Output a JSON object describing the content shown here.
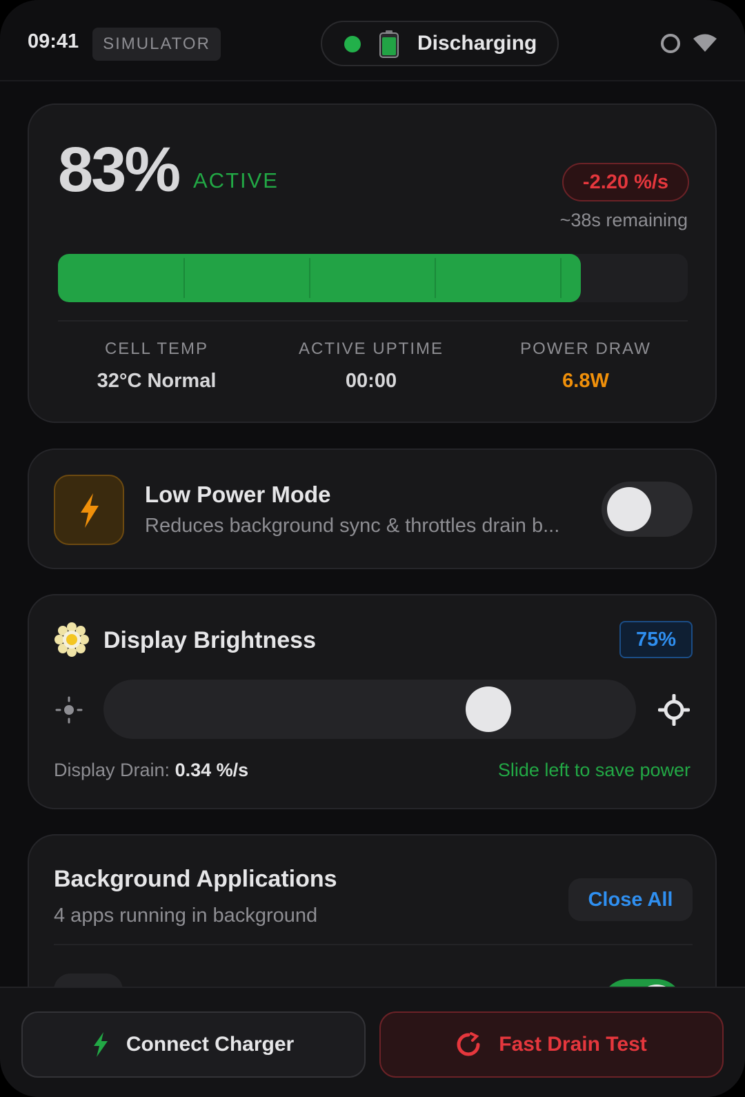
{
  "status_bar": {
    "time": "09:41",
    "mode_badge": "SIMULATOR",
    "charge_state": "Discharging",
    "status_dot_color": "#22b04a"
  },
  "battery": {
    "percent_label": "83%",
    "level_fraction": 0.83,
    "state": "ACTIVE",
    "rate": "-2.20 %/s",
    "remaining": "~38s remaining",
    "stats": [
      {
        "label": "CELL TEMP",
        "value": "32°C Normal"
      },
      {
        "label": "ACTIVE UPTIME",
        "value": "00:00"
      },
      {
        "label": "POWER DRAW",
        "value": "6.8W"
      }
    ],
    "fill_color": "#22a345"
  },
  "low_power": {
    "title": "Low Power Mode",
    "subtitle": "Reduces background sync & throttles drain b...",
    "enabled": false,
    "icon": "lightning-bolt-icon"
  },
  "brightness": {
    "title": "Display Brightness",
    "percent_label": "75%",
    "level_fraction": 0.75,
    "drain_label": "Display Drain:",
    "drain_value": "0.34 %/s",
    "hint": "Slide left to save power",
    "icon": "sun-icon"
  },
  "background_apps": {
    "title": "Background Applications",
    "subtitle": "4 apps running in background",
    "close_all_label": "Close All",
    "apps": [
      {
        "name": "",
        "enabled": true
      }
    ]
  },
  "actions": {
    "connect_charger_label": "Connect Charger",
    "fast_drain_label": "Fast Drain Test"
  },
  "colors": {
    "accent_green": "#22a845",
    "accent_red": "#e5373d",
    "accent_blue": "#2f8ff0",
    "accent_orange": "#f0900a"
  }
}
